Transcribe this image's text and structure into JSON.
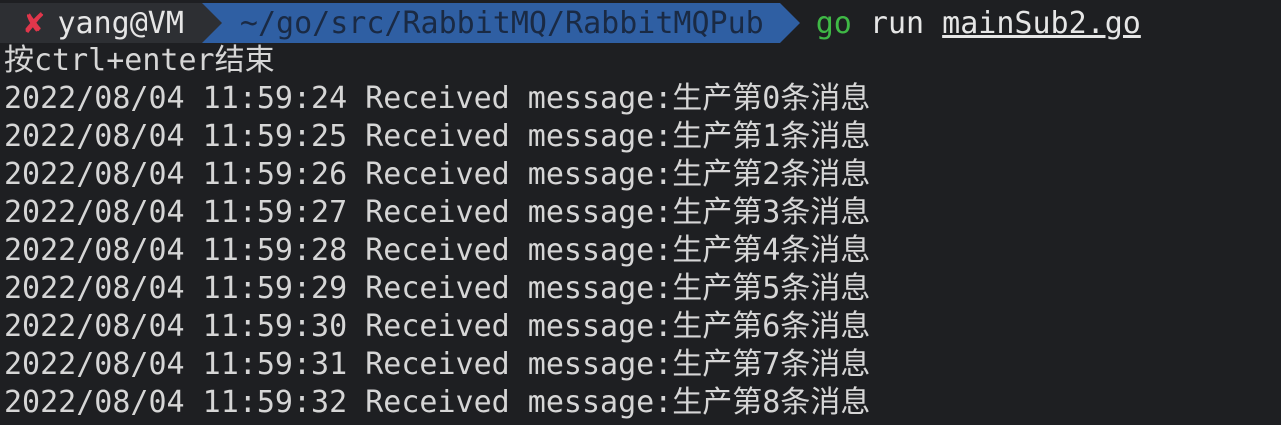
{
  "prompt": {
    "status_icon": "✘",
    "user_host": "yang@VM",
    "path": "~/go/src/RabbitMQ/RabbitMQPub",
    "command_word": "go",
    "command_rest": " run ",
    "command_file": "mainSub2.go"
  },
  "colors": {
    "background": "#1e1f22",
    "user_segment": "#2d2f33",
    "path_segment": "#2f5fa3",
    "error_icon": "#e0364b",
    "command_green": "#3fb846"
  },
  "output": {
    "hint": "按ctrl+enter结束",
    "lines": [
      "2022/08/04 11:59:24 Received message:生产第0条消息",
      "2022/08/04 11:59:25 Received message:生产第1条消息",
      "2022/08/04 11:59:26 Received message:生产第2条消息",
      "2022/08/04 11:59:27 Received message:生产第3条消息",
      "2022/08/04 11:59:28 Received message:生产第4条消息",
      "2022/08/04 11:59:29 Received message:生产第5条消息",
      "2022/08/04 11:59:30 Received message:生产第6条消息",
      "2022/08/04 11:59:31 Received message:生产第7条消息",
      "2022/08/04 11:59:32 Received message:生产第8条消息"
    ]
  }
}
